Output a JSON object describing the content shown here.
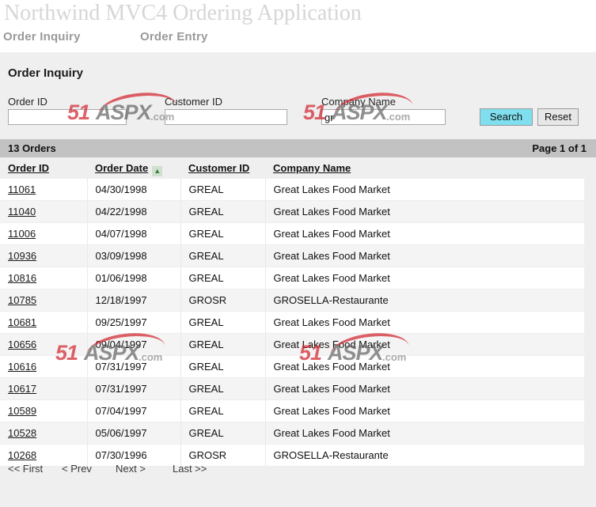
{
  "header": {
    "title": "Northwind MVC4 Ordering Application",
    "nav": [
      {
        "label": "Order Inquiry"
      },
      {
        "label": "Order Entry"
      }
    ]
  },
  "main": {
    "page_title": "Order Inquiry",
    "search": {
      "fields": [
        {
          "label": "Order ID",
          "value": "",
          "placeholder": ""
        },
        {
          "label": "Customer ID",
          "value": "",
          "placeholder": ""
        },
        {
          "label": "Company Name",
          "value": "gr",
          "placeholder": ""
        }
      ],
      "search_button": "Search",
      "reset_button": "Reset"
    },
    "summary": {
      "count_label": "13 Orders",
      "page_label": "Page 1 of 1"
    },
    "table": {
      "columns": [
        {
          "label": "Order ID",
          "sort": "none"
        },
        {
          "label": "Order Date",
          "sort": "asc"
        },
        {
          "label": "Customer ID",
          "sort": "none"
        },
        {
          "label": "Company Name",
          "sort": "none"
        }
      ],
      "sort_icon_asc": "▲",
      "rows": [
        {
          "order_id": "11061",
          "order_date": "04/30/1998",
          "customer_id": "GREAL",
          "company_name": "Great Lakes Food Market"
        },
        {
          "order_id": "11040",
          "order_date": "04/22/1998",
          "customer_id": "GREAL",
          "company_name": "Great Lakes Food Market"
        },
        {
          "order_id": "11006",
          "order_date": "04/07/1998",
          "customer_id": "GREAL",
          "company_name": "Great Lakes Food Market"
        },
        {
          "order_id": "10936",
          "order_date": "03/09/1998",
          "customer_id": "GREAL",
          "company_name": "Great Lakes Food Market"
        },
        {
          "order_id": "10816",
          "order_date": "01/06/1998",
          "customer_id": "GREAL",
          "company_name": "Great Lakes Food Market"
        },
        {
          "order_id": "10785",
          "order_date": "12/18/1997",
          "customer_id": "GROSR",
          "company_name": "GROSELLA-Restaurante"
        },
        {
          "order_id": "10681",
          "order_date": "09/25/1997",
          "customer_id": "GREAL",
          "company_name": "Great Lakes Food Market"
        },
        {
          "order_id": "10656",
          "order_date": "09/04/1997",
          "customer_id": "GREAL",
          "company_name": "Great Lakes Food Market"
        },
        {
          "order_id": "10616",
          "order_date": "07/31/1997",
          "customer_id": "GREAL",
          "company_name": "Great Lakes Food Market"
        },
        {
          "order_id": "10617",
          "order_date": "07/31/1997",
          "customer_id": "GREAL",
          "company_name": "Great Lakes Food Market"
        },
        {
          "order_id": "10589",
          "order_date": "07/04/1997",
          "customer_id": "GREAL",
          "company_name": "Great Lakes Food Market"
        },
        {
          "order_id": "10528",
          "order_date": "05/06/1997",
          "customer_id": "GREAL",
          "company_name": "Great Lakes Food Market"
        },
        {
          "order_id": "10268",
          "order_date": "07/30/1996",
          "customer_id": "GROSR",
          "company_name": "GROSELLA-Restaurante"
        }
      ]
    },
    "pager": [
      {
        "label": "<< First"
      },
      {
        "label": "< Prev"
      },
      {
        "label": "Next >"
      },
      {
        "label": "Last >>"
      }
    ]
  },
  "watermark": {
    "part1": "51",
    "part2": "ASPX",
    "part3": ".com"
  },
  "colors": {
    "page_background": "#efefef",
    "title_gray": "#d6d6d6",
    "nav_gray": "#999999",
    "count_bar": "#c2c2c2",
    "search_button": "#7fdfee",
    "reset_button": "#e7e7e7",
    "sort_indicator": "#3f7b3f",
    "watermark_red": "#d22630",
    "watermark_gray": "#666666",
    "row_alt": "#f4f4f4"
  }
}
